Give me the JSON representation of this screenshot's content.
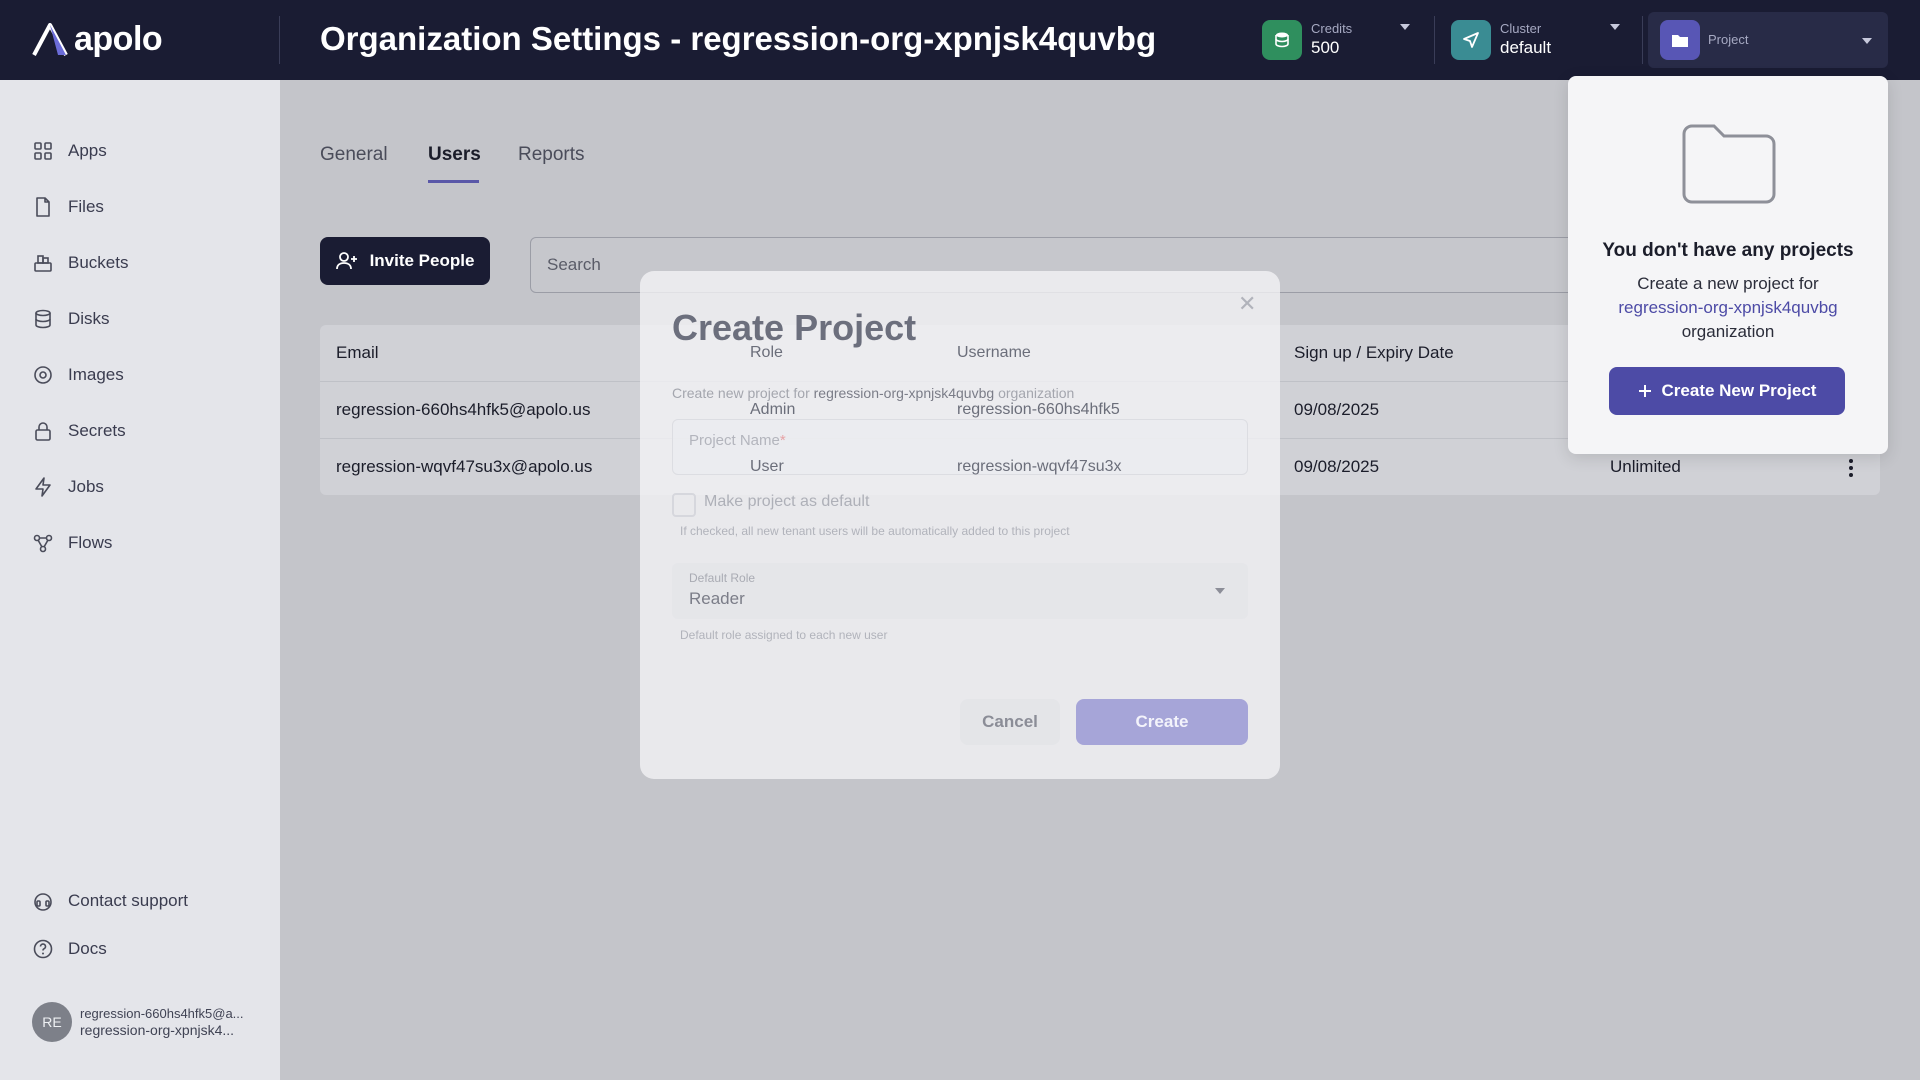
{
  "app": {
    "logo_text": "apolo",
    "page_title": "Organization Settings - regression-org-xpnjsk4quvbg"
  },
  "header": {
    "credits": {
      "label": "Credits",
      "value": "500"
    },
    "cluster": {
      "label": "Cluster",
      "value": "default"
    },
    "project": {
      "label": "Project"
    }
  },
  "sidebar": {
    "items": [
      {
        "label": "Apps",
        "icon": "grid-icon"
      },
      {
        "label": "Files",
        "icon": "file-icon"
      },
      {
        "label": "Buckets",
        "icon": "bucket-icon"
      },
      {
        "label": "Disks",
        "icon": "database-icon"
      },
      {
        "label": "Images",
        "icon": "disc-icon"
      },
      {
        "label": "Secrets",
        "icon": "lock-icon"
      },
      {
        "label": "Jobs",
        "icon": "lightning-icon"
      },
      {
        "label": "Flows",
        "icon": "flow-icon"
      }
    ],
    "contact_support": "Contact support",
    "docs": "Docs",
    "user": {
      "initials": "RE",
      "email": "regression-660hs4hfk5@a...",
      "org": "regression-org-xpnjsk4..."
    }
  },
  "tabs": [
    {
      "label": "General",
      "active": false
    },
    {
      "label": "Users",
      "active": true
    },
    {
      "label": "Reports",
      "active": false
    }
  ],
  "toolbar": {
    "invite_label": "Invite People",
    "search_placeholder": "Search"
  },
  "table": {
    "columns": [
      "Email",
      "Role",
      "Username",
      "Sign up / Expiry Date"
    ],
    "rows": [
      {
        "email": "regression-660hs4hfk5@apolo.us",
        "role": "Admin",
        "username": "regression-660hs4hfk5",
        "date": "09/08/2025",
        "credits": ""
      },
      {
        "email": "regression-wqvf47su3x@apolo.us",
        "role": "User",
        "username": "regression-wqvf47su3x",
        "date": "09/08/2025",
        "credits": "Unlimited"
      }
    ]
  },
  "modal": {
    "title": "Create Project",
    "subtitle_prefix": "Create new project for",
    "subtitle_org": "regression-org-xpnjsk4quvbg",
    "subtitle_suffix": "organization",
    "project_name_label": "Project Name",
    "required_mark": "*",
    "default_checkbox_label": "Make project as default",
    "default_checkbox_help": "If checked, all new tenant users will be automatically added to this project",
    "default_role_label": "Default Role",
    "default_role_value": "Reader",
    "default_role_help": "Default role assigned to each new user",
    "cancel_label": "Cancel",
    "create_label": "Create"
  },
  "projects_popover": {
    "title": "You don't have any projects",
    "desc_prefix": "Create a new project for",
    "org": "regression-org-xpnjsk4quvbg",
    "desc_suffix": "organization",
    "button_label": "Create New Project"
  },
  "colors": {
    "header_bg": "#1a1c33",
    "accent": "#4d4ba6",
    "credits_icon": "#2f8f5e",
    "cluster_icon": "#3a8c93",
    "project_icon": "#5856b5"
  }
}
